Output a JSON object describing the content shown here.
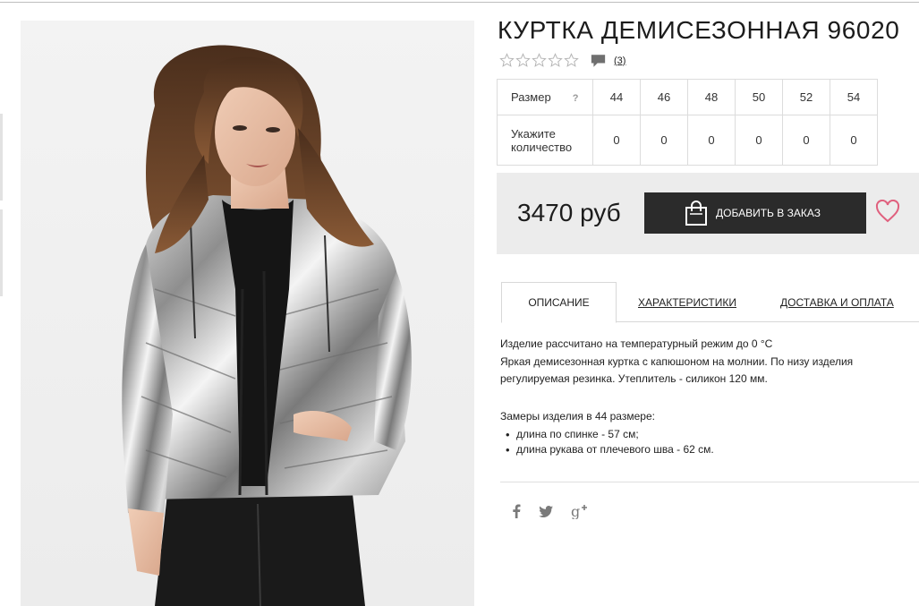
{
  "product": {
    "title": "КУРТКА ДЕМИСЕЗОННАЯ 96020",
    "rating": {
      "stars": 0,
      "max": 5,
      "reviews_label": "(3)"
    },
    "image_alt": "photo"
  },
  "sizes": {
    "header_label": "Размер",
    "help_label": "?",
    "qty_label_line1": "Укажите",
    "qty_label_line2": "количество",
    "values": [
      "44",
      "46",
      "48",
      "50",
      "52",
      "54"
    ],
    "quantities": [
      "0",
      "0",
      "0",
      "0",
      "0",
      "0"
    ]
  },
  "buy": {
    "price": "3470 руб",
    "add_label": "ДОБАВИТЬ В ЗАКАЗ"
  },
  "tabs": [
    {
      "label": "ОПИСАНИЕ",
      "active": true
    },
    {
      "label": "ХАРАКТЕРИСТИКИ",
      "active": false
    },
    {
      "label": "ДОСТАВКА И ОПЛАТА",
      "active": false
    }
  ],
  "description": {
    "line1": "Изделие рассчитано на температурный режим до 0 °C",
    "line2": "Яркая демисезонная куртка с капюшоном на молнии. По низу изделия",
    "line3": "регулируемая резинка. Утеплитель - силикон 120 мм.",
    "measures_title": "Замеры изделия в 44 размере:",
    "measures": [
      "длина по спинке - 57 см;",
      "длина рукава от плечевого шва - 62 см."
    ]
  },
  "colors": {
    "accent_dark": "#2b2b2b",
    "panel_bg": "#ececec",
    "heart": "#e0607e"
  },
  "social_icons": [
    "facebook-icon",
    "twitter-icon",
    "google-plus-icon"
  ]
}
